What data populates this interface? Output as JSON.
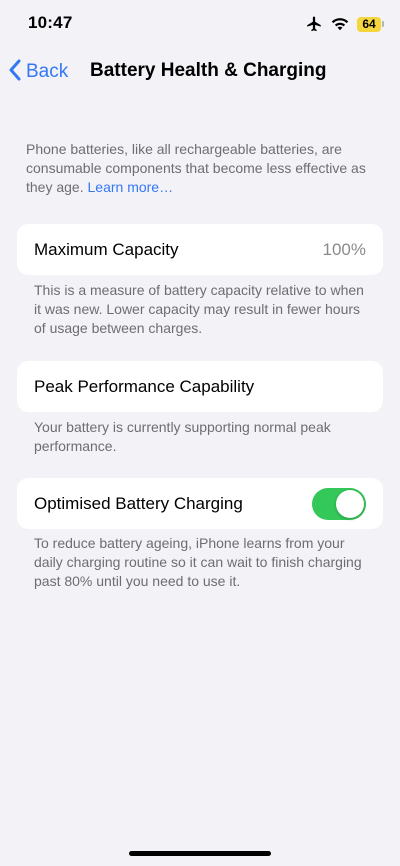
{
  "status_bar": {
    "time": "10:47",
    "battery_level": "64",
    "icons": [
      "airplane-icon",
      "wifi-icon",
      "battery-icon"
    ]
  },
  "nav": {
    "back_label": "Back",
    "title": "Battery Health & Charging"
  },
  "intro": {
    "text": "Phone batteries, like all rechargeable batteries, are consumable components that become less effective as they age. ",
    "link": "Learn more…"
  },
  "maximum_capacity": {
    "label": "Maximum Capacity",
    "value": "100%",
    "footnote": "This is a measure of battery capacity relative to when it was new. Lower capacity may result in fewer hours of usage between charges."
  },
  "peak_performance": {
    "label": "Peak Performance Capability",
    "footnote": "Your battery is currently supporting normal peak performance."
  },
  "optimised_charging": {
    "label": "Optimised Battery Charging",
    "enabled": true,
    "footnote": "To reduce battery ageing, iPhone learns from your daily charging routine so it can wait to finish charging past 80% until you need to use it."
  },
  "colors": {
    "accent": "#3478f6",
    "toggle_on": "#34c759",
    "background": "#f2f2f7",
    "battery": "#f4d63c"
  }
}
